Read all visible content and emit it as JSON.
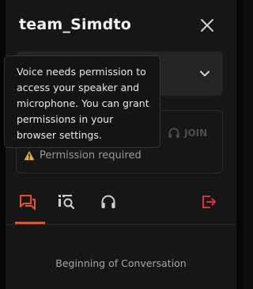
{
  "header": {
    "title": "team_Simdto"
  },
  "voice": {
    "join_label": "JOIN",
    "permission_text": "Permission required",
    "tooltip_text": "Voice needs permission to access your speaker and microphone. You can grant permissions in your browser settings."
  },
  "tabs": [
    {
      "icon": "chat-icon",
      "active": true
    },
    {
      "icon": "search-list-icon",
      "active": false
    },
    {
      "icon": "headphones-icon",
      "active": false
    },
    {
      "icon": "exit-icon",
      "active": false
    }
  ],
  "conversation": {
    "start_text": "Beginning of Conversation"
  },
  "colors": {
    "accent": "#e8531f",
    "exit": "#e0303a",
    "warning": "#e8b23a"
  }
}
